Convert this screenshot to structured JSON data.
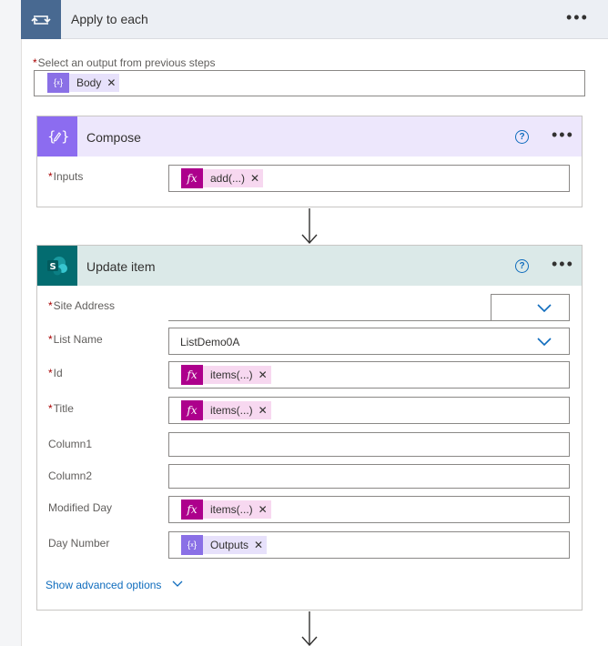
{
  "apply_to_each": {
    "title": "Apply to each",
    "select_label": "Select an output from previous steps",
    "token": "Body"
  },
  "compose": {
    "title": "Compose",
    "inputs_label": "Inputs",
    "inputs_token": "add(...)"
  },
  "update_item": {
    "title": "Update item",
    "fields": {
      "site_address": {
        "label": "Site Address",
        "value": ""
      },
      "list_name": {
        "label": "List Name",
        "value": "ListDemo0A"
      },
      "id": {
        "label": "Id",
        "token": "items(...)"
      },
      "title": {
        "label": "Title",
        "token": "items(...)"
      },
      "column1": {
        "label": "Column1",
        "value": ""
      },
      "column2": {
        "label": "Column2",
        "value": ""
      },
      "modified_day": {
        "label": "Modified Day",
        "token": "items(...)"
      },
      "day_number": {
        "label": "Day Number",
        "token": "Outputs"
      }
    },
    "advanced_link": "Show advanced options"
  },
  "icons": {
    "loop": "loop-icon",
    "compose": "compose-icon",
    "sharepoint": "sharepoint-icon",
    "expression": "fx-icon",
    "variable": "variable-icon"
  },
  "colors": {
    "apply_header_icon": "#486991",
    "compose_header": "#ede7fc",
    "compose_icon": "#8c6cf0",
    "sharepoint_header": "#dbe9e8",
    "sharepoint_icon": "#036c70",
    "expression_token": "#ad008c",
    "link": "#0f6cbd"
  }
}
